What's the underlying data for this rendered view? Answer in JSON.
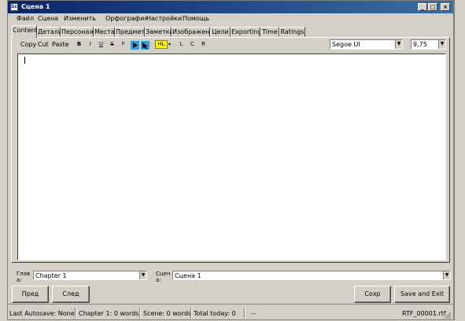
{
  "window": {
    "title": "Сцена 1",
    "minimize": "_",
    "maximize": "□",
    "close": "×"
  },
  "menu": [
    "Файл",
    "Сцена",
    "Изменить",
    "Орфография",
    "Настройки",
    "Помощь"
  ],
  "tabs": [
    "Content",
    "Детали",
    "Персонажи",
    "Места",
    "Предметы",
    "Заметки",
    "Изображение",
    "Цели",
    "Exporting",
    "Time",
    "Ratings"
  ],
  "toolbar": {
    "copy": "Copy",
    "cut": "Cut",
    "paste": "Paste",
    "bold": "B",
    "italic": "I",
    "underline": "U",
    "strike": "S",
    "p": "P",
    "highlight": "HL",
    "align_left": "L",
    "align_center": "C",
    "align_right": "R",
    "font": "Segoe UI",
    "size": "9,75"
  },
  "chapter": {
    "label_1": "Глав",
    "label_2": "а:",
    "value": "Chapter 1"
  },
  "scene": {
    "label_1": "Сцен",
    "label_2": "а:",
    "value": "Сцена 1"
  },
  "buttons": {
    "prev": "Пред",
    "next": "След",
    "save": "Сохр",
    "save_exit": "Save and Exit"
  },
  "status": {
    "autosave": "Last Autosave: None",
    "chapter_words": "Chapter 1: 0 words",
    "scene_words": "Scene: 0 words",
    "total_today": "Total today: 0",
    "dash": "--",
    "file": "RTF_00001.rtf"
  },
  "colors": {
    "titlebar": "#0a246a",
    "face": "#d4d0c8",
    "editor": "#ffffff",
    "highlight": "#ffff00",
    "play_button": "#3a9ad9"
  }
}
